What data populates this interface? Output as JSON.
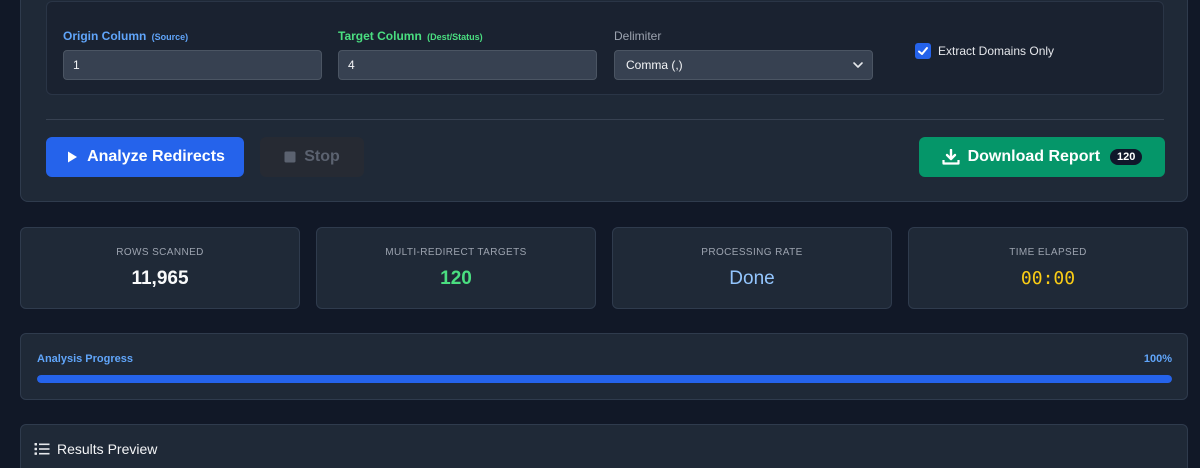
{
  "config": {
    "origin": {
      "label": "Origin Column",
      "hint": "(Source)",
      "value": "1"
    },
    "target": {
      "label": "Target Column",
      "hint": "(Dest/Status)",
      "value": "4"
    },
    "delimiter": {
      "label": "Delimiter",
      "selected": "Comma (,)"
    },
    "extract_domains": {
      "label": "Extract Domains Only",
      "checked": true
    }
  },
  "actions": {
    "analyze_label": "Analyze Redirects",
    "stop_label": "Stop",
    "download_label": "Download Report",
    "download_count": "120"
  },
  "stats": {
    "rows_scanned": {
      "label": "ROWS SCANNED",
      "value": "11,965"
    },
    "multi_redirect": {
      "label": "MULTI-REDIRECT TARGETS",
      "value": "120"
    },
    "processing_rate": {
      "label": "PROCESSING RATE",
      "value": "Done"
    },
    "time_elapsed": {
      "label": "TIME ELAPSED",
      "value": "00:00"
    }
  },
  "progress": {
    "title": "Analysis Progress",
    "percent_label": "100%",
    "fraction": 1.0
  },
  "results": {
    "title": "Results Preview"
  },
  "icons": {
    "analyze": "play-icon",
    "stop": "stop-icon",
    "download": "download-icon",
    "results": "list-icon",
    "select": "chevron-down-icon",
    "checkbox": "check-icon"
  },
  "colors": {
    "background": "#111827",
    "card": "#1f2937",
    "primary": "#2563eb",
    "success": "#059669",
    "accent_blue": "#60a5fa",
    "accent_green": "#4ade80",
    "accent_yellow": "#facc15"
  }
}
